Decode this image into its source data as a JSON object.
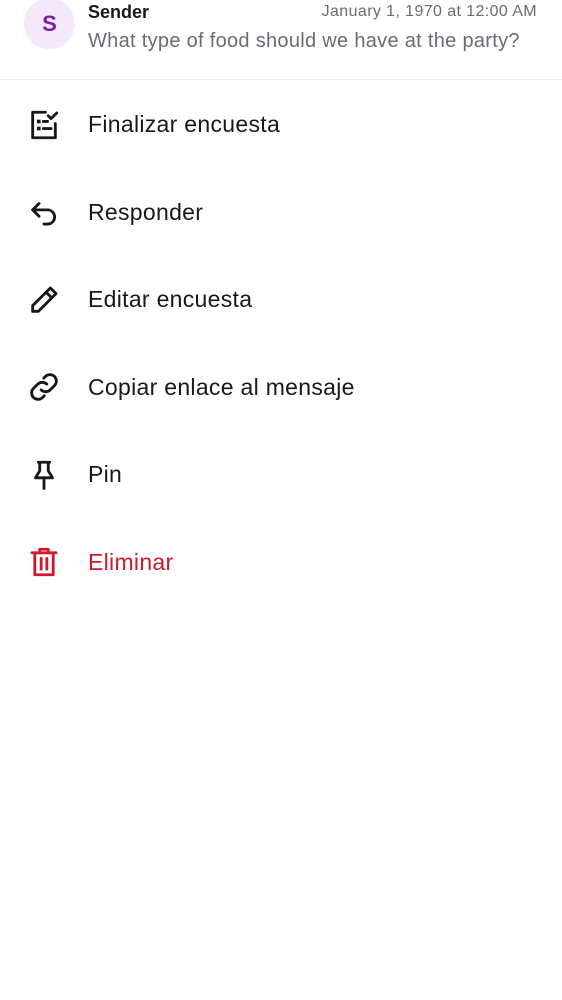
{
  "message": {
    "avatar_initial": "S",
    "sender": "Sender",
    "timestamp": "January 1, 1970 at 12:00 AM",
    "snippet": "What type of food should we have at the party?"
  },
  "menu": {
    "items": [
      {
        "label": "Finalizar encuesta",
        "icon": "end-poll-icon"
      },
      {
        "label": "Responder",
        "icon": "reply-icon"
      },
      {
        "label": "Editar encuesta",
        "icon": "pencil-icon"
      },
      {
        "label": "Copiar enlace al mensaje",
        "icon": "link-icon"
      },
      {
        "label": "Pin",
        "icon": "pin-icon"
      },
      {
        "label": "Eliminar",
        "icon": "trash-icon"
      }
    ]
  },
  "colors": {
    "text": "#18181b",
    "muted": "#6b6b74",
    "danger": "#d0182c",
    "avatar_bg": "#f6e8fb",
    "avatar_fg": "#7b1f9e"
  }
}
